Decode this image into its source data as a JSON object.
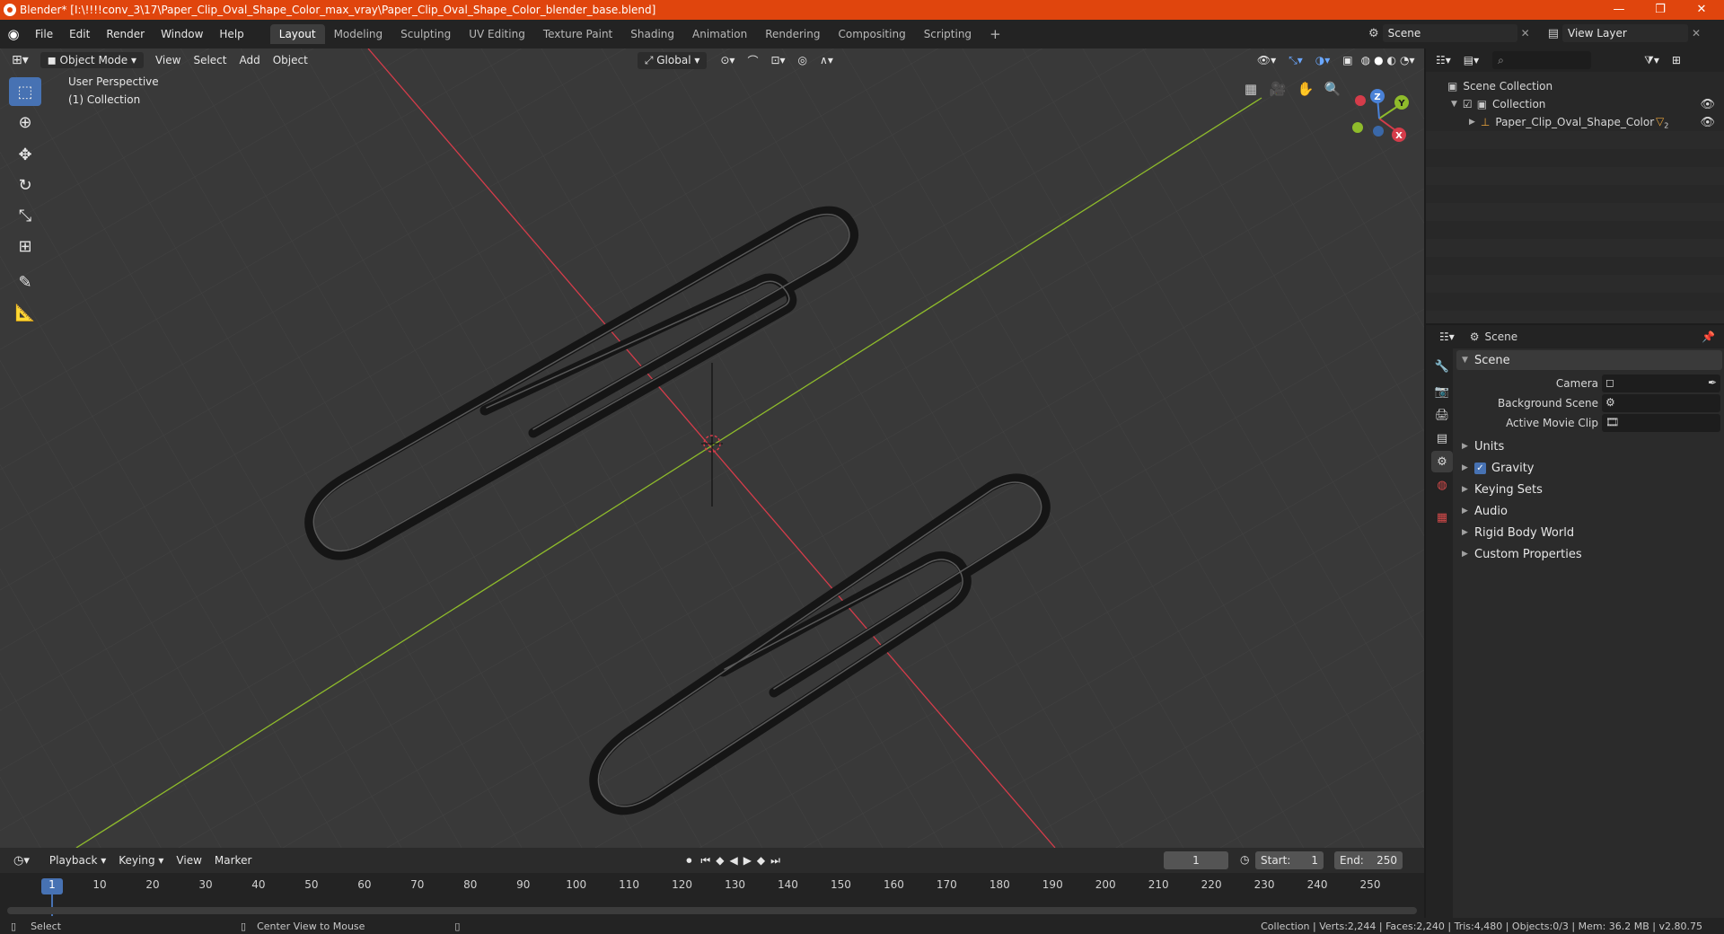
{
  "titlebar": {
    "title": "Blender* [I:\\!!!!conv_3\\17\\Paper_Clip_Oval_Shape_Color_max_vray\\Paper_Clip_Oval_Shape_Color_blender_base.blend]",
    "minimize": "—",
    "maximize": "❐",
    "close": "✕"
  },
  "menubar": {
    "menus": [
      "File",
      "Edit",
      "Render",
      "Window",
      "Help"
    ],
    "workspaces": [
      "Layout",
      "Modeling",
      "Sculpting",
      "UV Editing",
      "Texture Paint",
      "Shading",
      "Animation",
      "Rendering",
      "Compositing",
      "Scripting"
    ],
    "add_tab": "+",
    "scene": "Scene",
    "view_layer": "View Layer"
  },
  "viewport": {
    "mode": "Object Mode",
    "menus": [
      "View",
      "Select",
      "Add",
      "Object"
    ],
    "transform_orientation": "Global",
    "overlay_title": "User Perspective",
    "overlay_collection": "(1) Collection",
    "gizmo_axes": [
      "X",
      "Y",
      "Z"
    ]
  },
  "outliner": {
    "root": "Scene Collection",
    "collection": "Collection",
    "object": "Paper_Clip_Oval_Shape_Color",
    "modifier_count": "2"
  },
  "properties": {
    "header_title": "Scene",
    "panel_title": "Scene",
    "fields": [
      {
        "label": "Camera"
      },
      {
        "label": "Background Scene"
      },
      {
        "label": "Active Movie Clip"
      }
    ],
    "subpanels": [
      "Units",
      "Gravity",
      "Keying Sets",
      "Audio",
      "Rigid Body World",
      "Custom Properties"
    ],
    "gravity_checked": true
  },
  "timeline": {
    "menus": [
      "Playback",
      "Keying",
      "View",
      "Marker"
    ],
    "current_frame": "1",
    "start_label": "Start:",
    "start": "1",
    "end_label": "End:",
    "end": "250",
    "ticks": [
      "1",
      "10",
      "20",
      "30",
      "40",
      "50",
      "60",
      "70",
      "80",
      "90",
      "100",
      "110",
      "120",
      "130",
      "140",
      "150",
      "160",
      "170",
      "180",
      "190",
      "200",
      "210",
      "220",
      "230",
      "240",
      "250"
    ]
  },
  "statusbar": {
    "left_action": "Select",
    "mid_action": "Center View to Mouse",
    "stats": "Collection | Verts:2,244 | Faces:2,240 | Tris:4,480 | Objects:0/3 | Mem: 36.2 MB | v2.80.75"
  },
  "colors": {
    "titlebar": "#e0450d",
    "accent": "#4772b3",
    "viewport_bg": "#393939",
    "axis_x": "#d53c4a",
    "axis_y": "#8fbc2b"
  }
}
